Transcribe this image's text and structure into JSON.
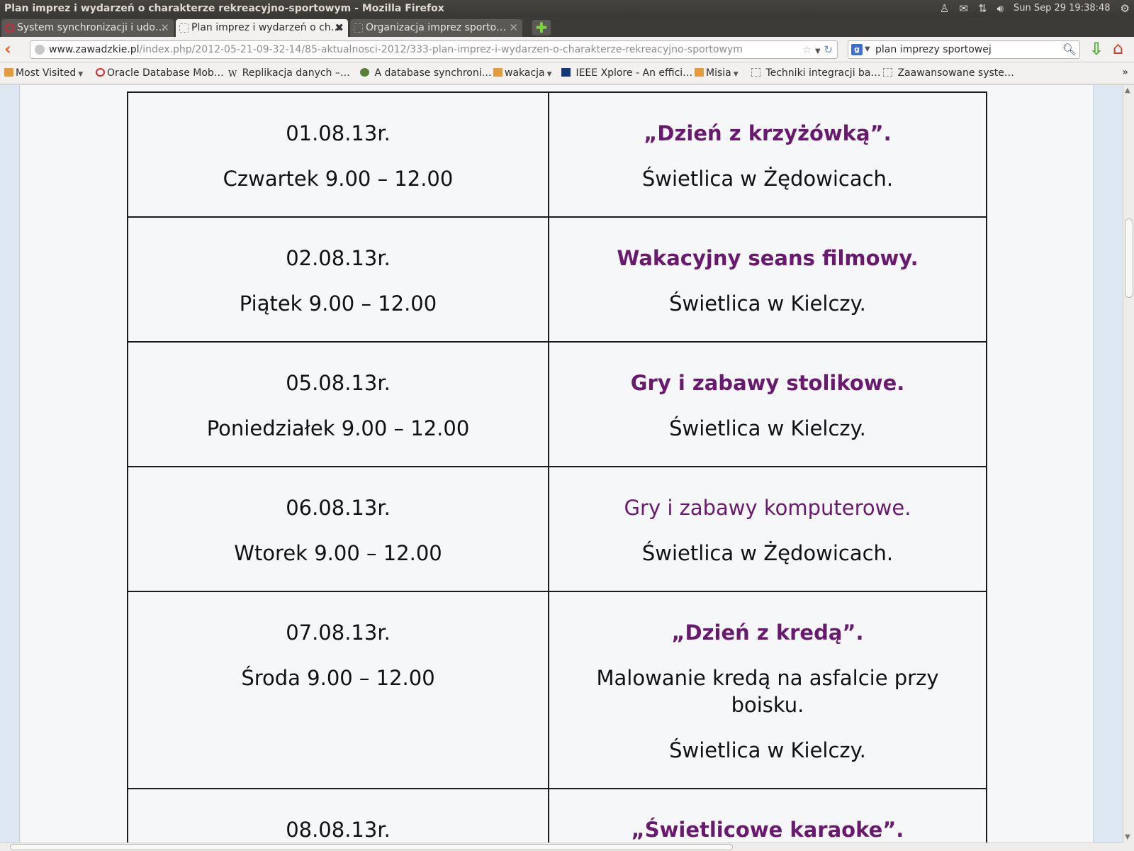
{
  "window": {
    "title": "Plan imprez i wydarzeń o charakterze rekreacyjno-sportowym - Mozilla Firefox",
    "clock": "Sun Sep 29  19:38:48"
  },
  "tabs": [
    {
      "label": "System synchronizacji i udo…",
      "icon": "oracle-icon"
    },
    {
      "label": "Plan imprez i wydarzeń o ch…",
      "icon": "blank-page-icon"
    },
    {
      "label": "Organizacja imprez sporto…",
      "icon": "blank-page-icon"
    }
  ],
  "nav": {
    "url_host": "www.zawadzkie.pl",
    "url_path": "/index.php/2012-05-21-09-32-14/85-aktualnosci-2012/333-plan-imprez-i-wydarzen-o-charakterze-rekreacyjno-sportowym",
    "search_value": "plan imprezy sportowej"
  },
  "bookmarks": [
    {
      "label": "Most Visited",
      "icon": "folder-icon",
      "dropdown": true
    },
    {
      "label": "Oracle Database Mob…",
      "icon": "oracle-icon"
    },
    {
      "label": "Replikacja danych –…",
      "icon": "wikipedia-icon"
    },
    {
      "label": "A database synchroni…",
      "icon": "gear-icon"
    },
    {
      "label": "wakacja",
      "icon": "folder-icon",
      "dropdown": true
    },
    {
      "label": "IEEE Xplore - An effici…",
      "icon": "ieee-icon"
    },
    {
      "label": "Misia",
      "icon": "folder-icon",
      "dropdown": true
    },
    {
      "label": "Techniki integracji ba…",
      "icon": "blank-page-icon"
    },
    {
      "label": "Zaawansowane syste…",
      "icon": "blank-page-icon"
    }
  ],
  "schedule": [
    {
      "date": "01.08.13r.",
      "time": "Czwartek 9.00 – 12.00",
      "title": "„Dzień z krzyżówką”.",
      "title_bold": true,
      "details": [],
      "place": "Świetlica w Żędowicach."
    },
    {
      "date": "02.08.13r.",
      "time": "Piątek 9.00 – 12.00",
      "title": "Wakacyjny seans filmowy.",
      "title_bold": true,
      "details": [],
      "place": "Świetlica w Kielczy."
    },
    {
      "date": "05.08.13r.",
      "time": "Poniedziałek 9.00 – 12.00",
      "title": "Gry i zabawy stolikowe.",
      "title_bold": true,
      "details": [],
      "place": "Świetlica w Kielczy."
    },
    {
      "date": "06.08.13r.",
      "time": "Wtorek 9.00 – 12.00",
      "title": "Gry i zabawy komputerowe.",
      "title_bold": false,
      "details": [],
      "place": "Świetlica w Żędowicach."
    },
    {
      "date": "07.08.13r.",
      "time": "Środa 9.00 – 12.00",
      "title": "„Dzień z kredą”.",
      "title_bold": true,
      "details": [
        "Malowanie kredą na asfalcie przy boisku."
      ],
      "place": "Świetlica w Kielczy."
    },
    {
      "date": "08.08.13r.",
      "time": "",
      "title": "„Świetlicowe karaoke”.",
      "title_bold": true,
      "details": [],
      "place": ""
    }
  ],
  "colors": {
    "event_title": "#6a1a6e",
    "page_bg": "#f5f7f9",
    "outer_bg": "#dde8f3"
  }
}
